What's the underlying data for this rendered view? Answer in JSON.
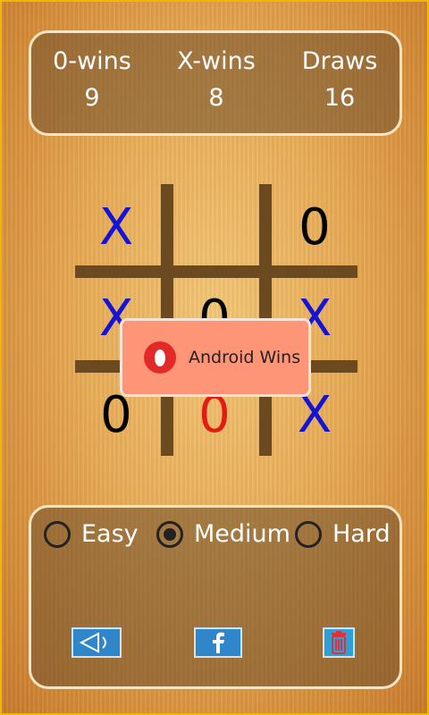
{
  "scoreboard": {
    "o_wins_label": "0-wins",
    "x_wins_label": "X-wins",
    "draws_label": "Draws",
    "o_wins": "9",
    "x_wins": "8",
    "draws": "16"
  },
  "board": {
    "cells": [
      {
        "mark": "X",
        "color": "#1414d8"
      },
      {
        "mark": "",
        "color": "#000000"
      },
      {
        "mark": "0",
        "color": "#000000"
      },
      {
        "mark": "X",
        "color": "#1414d8"
      },
      {
        "mark": "0",
        "color": "#000000"
      },
      {
        "mark": "X",
        "color": "#1414d8"
      },
      {
        "mark": "0",
        "color": "#000000"
      },
      {
        "mark": "0",
        "color": "#e31b12"
      },
      {
        "mark": "X",
        "color": "#1414d8"
      }
    ]
  },
  "toast": {
    "message": "Android Wins",
    "icon": "o-mark-icon"
  },
  "difficulty": {
    "options": [
      "Easy",
      "Medium",
      "Hard"
    ],
    "selected": "Medium"
  },
  "actions": {
    "sound_icon": "speaker-icon",
    "share_icon": "facebook-icon",
    "delete_icon": "trash-icon"
  },
  "colors": {
    "x_mark": "#1414d8",
    "o_mark": "#000000",
    "winning_o": "#e31b12",
    "toast_bg": "#ff9577",
    "button_blue": "#2f86c8"
  }
}
